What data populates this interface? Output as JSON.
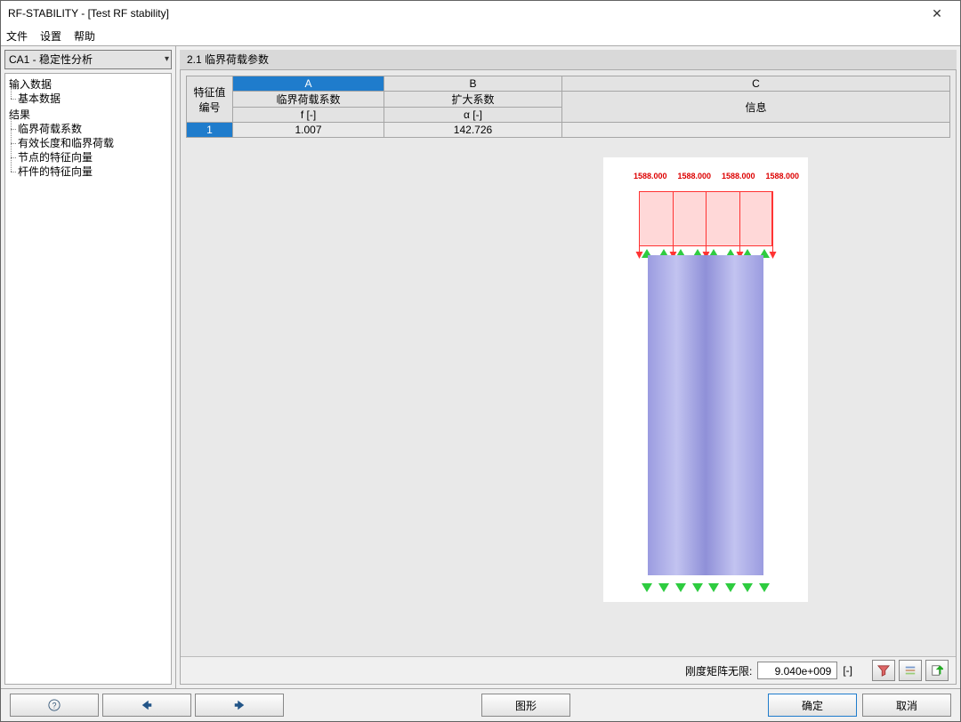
{
  "titlebar": {
    "text": "RF-STABILITY - [Test RF stability]"
  },
  "menu": {
    "file": "文件",
    "settings": "设置",
    "help": "帮助"
  },
  "left": {
    "combo": "CA1 - 稳定性分析",
    "tree": {
      "input": "输入数据",
      "input_basic": "基本数据",
      "results": "结果",
      "r1": "临界荷载系数",
      "r2": "有效长度和临界荷载",
      "r3": "节点的特征向量",
      "r4": "杆件的特征向量"
    }
  },
  "section": {
    "title": "2.1 临界荷载参数"
  },
  "table": {
    "rowhead": "特征值\n编号",
    "colA": "A",
    "colB": "B",
    "colC": "C",
    "colA_sub1": "临界荷载系数",
    "colA_sub2": "f [-]",
    "colB_sub1": "扩大系数",
    "colB_sub2": "α [-]",
    "colC_sub": "信息",
    "rows": [
      {
        "idx": "1",
        "f": "1.007",
        "alpha": "142.726",
        "info": ""
      }
    ]
  },
  "diagram": {
    "load_value": "1588.000"
  },
  "status": {
    "label": "刚度矩阵无限:",
    "value": "9.040e+009",
    "unit": "[-]"
  },
  "footer": {
    "graph": "图形",
    "ok": "确定",
    "cancel": "取消"
  }
}
